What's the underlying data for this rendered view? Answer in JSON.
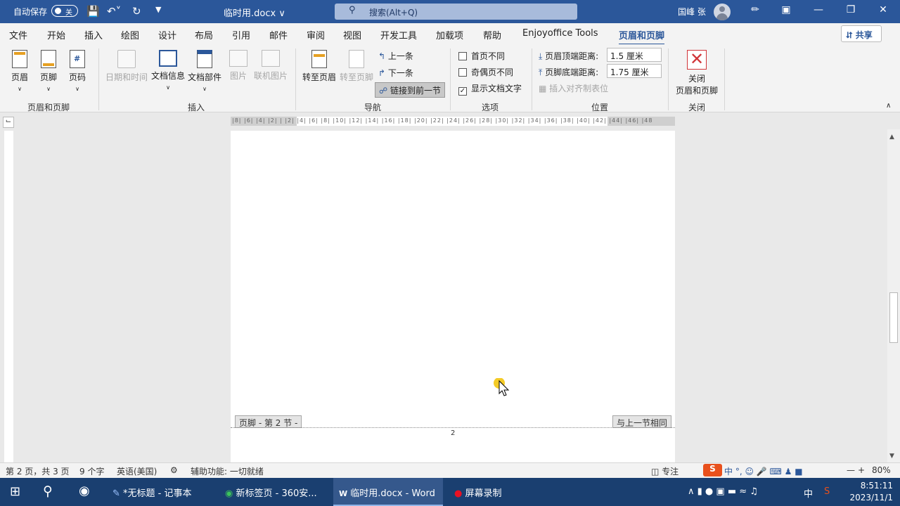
{
  "titlebar": {
    "autosave_label": "自动保存",
    "autosave_state": "关",
    "doc_title": "临时用.docx",
    "search_placeholder": "搜索(Alt+Q)",
    "user_name": "国峰 张"
  },
  "tabs": [
    "文件",
    "开始",
    "插入",
    "绘图",
    "设计",
    "布局",
    "引用",
    "邮件",
    "审阅",
    "视图",
    "开发工具",
    "加载项",
    "帮助",
    "Enjoyoffice Tools",
    "页眉和页脚"
  ],
  "active_tab": "页眉和页脚",
  "share_label": "共享",
  "ribbon": {
    "hf_group": {
      "label": "页眉和页脚",
      "header": "页眉",
      "footer": "页脚",
      "page_number": "页码"
    },
    "insert_group": {
      "label": "插入",
      "date_time": "日期和时间",
      "doc_info": "文档信息",
      "doc_parts": "文档部件",
      "picture": "图片",
      "online_picture": "联机图片"
    },
    "nav_group": {
      "label": "导航",
      "goto_header": "转至页眉",
      "goto_footer": "转至页脚",
      "previous": "上一条",
      "next": "下一条",
      "link_previous": "链接到前一节"
    },
    "options_group": {
      "label": "选项",
      "different_first": "首页不同",
      "different_odd_even": "奇偶页不同",
      "show_doc_text": "显示文档文字"
    },
    "position_group": {
      "label": "位置",
      "header_from_top": "页眉顶端距离:",
      "header_from_top_value": "1.5 厘米",
      "footer_from_bottom": "页脚底端距离:",
      "footer_from_bottom_value": "1.75 厘米",
      "insert_align_tab": "插入对齐制表位"
    },
    "close_group": {
      "label": "关闭",
      "close_hf_line1": "关闭",
      "close_hf_line2": "页眉和页脚"
    }
  },
  "ruler_numbers": "|8| |6| |4| |2| | |2| |4| |6| |8| |10| |12| |14| |16| |18| |20| |22| |24| |26| |28| |30| |32| |34| |36| |38| |40| |42| |44| |46| |48",
  "document": {
    "footer_label": "页脚 - 第 2 节 -",
    "same_as_previous": "与上一节相同",
    "page_number": "2"
  },
  "statusbar": {
    "page": "第 2 页，共 3 页",
    "words": "9 个字",
    "language": "英语(美国)",
    "accessibility": "辅助功能: 一切就绪",
    "focus": "专注",
    "zoom": "80%"
  },
  "taskbar": {
    "notepad": "*无标题 - 记事本",
    "browser": "新标签页 - 360安...",
    "word": "临时用.docx - Word",
    "recorder": "屏幕录制",
    "ime": "中",
    "time": "8:51:11",
    "date": "2023/11/1"
  }
}
